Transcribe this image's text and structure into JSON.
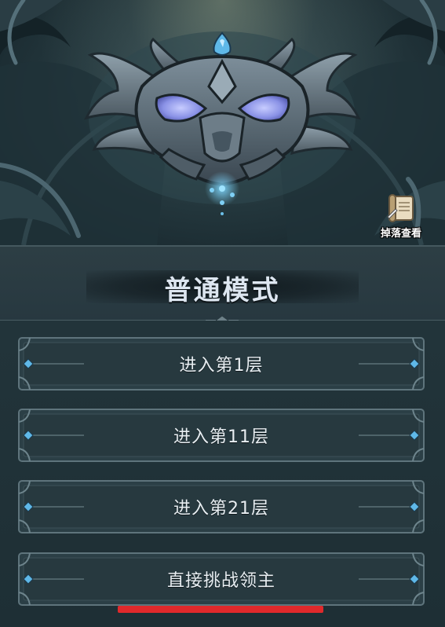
{
  "loot": {
    "label": "掉落查看",
    "icon": "scroll-icon"
  },
  "mode": {
    "title": "普通模式"
  },
  "floors": [
    {
      "label": "进入第1层"
    },
    {
      "label": "进入第11层"
    },
    {
      "label": "进入第21层"
    },
    {
      "label": "直接挑战领主"
    }
  ],
  "colors": {
    "accent_gem": "#5fb8e8",
    "button_text": "#e8eef2",
    "title_text": "#dde6f0",
    "highlight_underline": "#e0292b",
    "boss_eyes": "#8a92e6"
  }
}
